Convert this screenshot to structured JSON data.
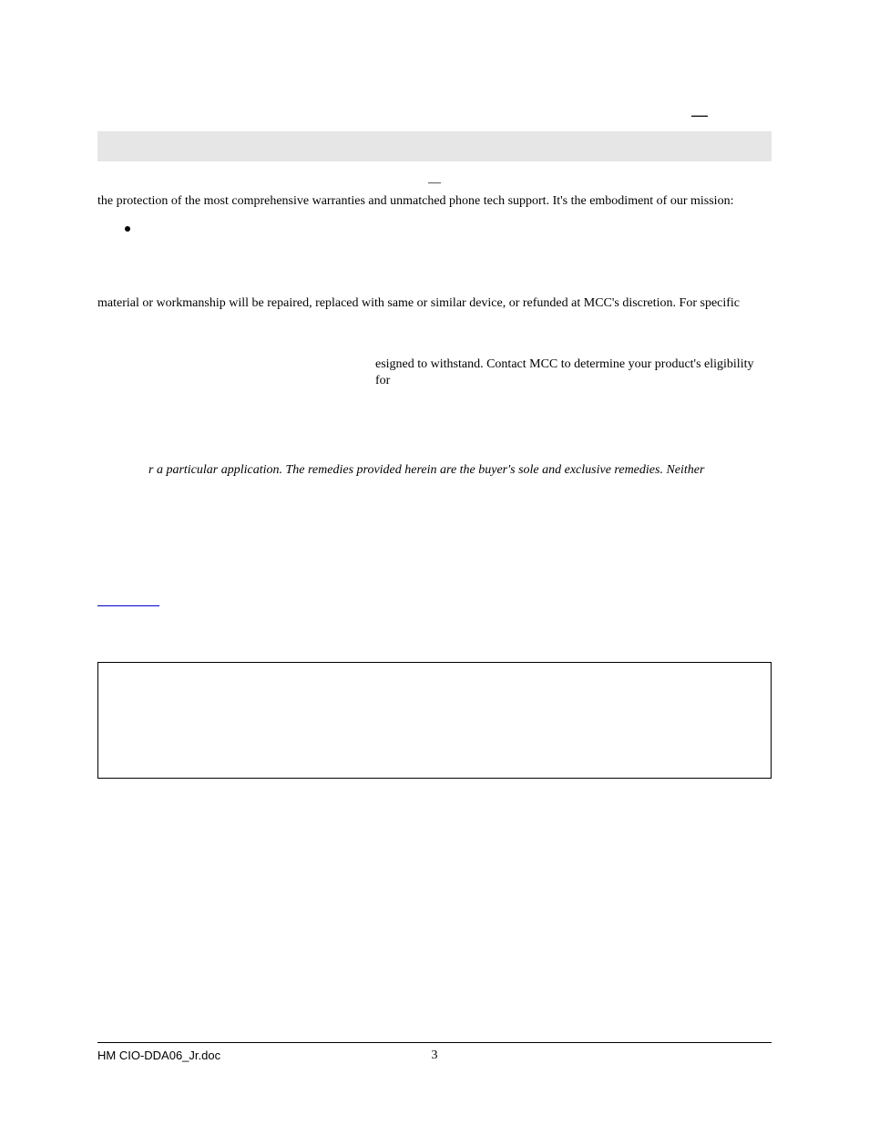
{
  "top_mark": "—",
  "center_dash": "—",
  "paragraphs": {
    "p1": "the protection of the most comprehensive warranties and unmatched phone tech support. It's the embodiment of our mission:",
    "p2": "material or workmanship will be repaired, replaced with same or similar device, or refunded at MCC's discretion. For specific",
    "p3": "esigned to withstand. Contact MCC to determine your product's eligibility for",
    "p4": "r a particular application. The remedies provided herein are the buyer's sole and exclusive remedies. Neither"
  },
  "footer": {
    "doc_name": "HM CIO-DDA06_Jr.doc",
    "page_number": "3"
  }
}
